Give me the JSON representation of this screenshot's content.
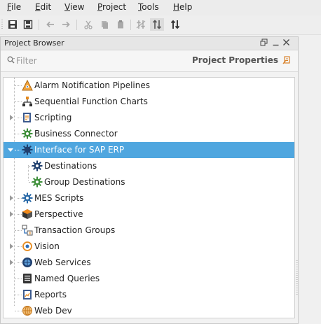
{
  "menu": {
    "items": [
      {
        "label": "File",
        "mnemonic": "F",
        "rest": "ile"
      },
      {
        "label": "Edit",
        "mnemonic": "E",
        "rest": "dit"
      },
      {
        "label": "View",
        "mnemonic": "V",
        "rest": "iew"
      },
      {
        "label": "Project",
        "mnemonic": "P",
        "rest": "roject"
      },
      {
        "label": "Tools",
        "mnemonic": "T",
        "rest": "ools"
      },
      {
        "label": "Help",
        "mnemonic": "H",
        "rest": "elp"
      }
    ]
  },
  "toolbar": {
    "buttons": [
      "save-icon",
      "save-all-icon",
      "undo-icon",
      "redo-icon",
      "cut-icon",
      "copy-icon",
      "paste-icon",
      "comms-off-icon",
      "comms-read-only-icon",
      "comms-read-write-icon"
    ],
    "active": "comms-read-only-icon"
  },
  "panel": {
    "title": "Project Browser",
    "filter_placeholder": "Filter",
    "project_properties_label": "Project Properties",
    "controls": [
      "restore-icon",
      "minimize-icon",
      "close-icon"
    ]
  },
  "tree": {
    "items": [
      {
        "label": "Alarm Notification Pipelines",
        "icon": "alarm-pipeline-icon",
        "expandable": false
      },
      {
        "label": "Sequential Function Charts",
        "icon": "sfc-icon",
        "expandable": false
      },
      {
        "label": "Scripting",
        "icon": "scripting-icon",
        "expandable": true,
        "expanded": false
      },
      {
        "label": "Business Connector",
        "icon": "business-connector-icon",
        "expandable": false
      },
      {
        "label": "Interface for SAP ERP",
        "icon": "sap-interface-icon",
        "expandable": true,
        "expanded": true,
        "selected": true
      },
      {
        "label": "Destinations",
        "icon": "destinations-icon",
        "child": true
      },
      {
        "label": "Group Destinations",
        "icon": "group-destinations-icon",
        "child": true
      },
      {
        "label": "MES Scripts",
        "icon": "mes-scripts-icon",
        "expandable": true,
        "expanded": false
      },
      {
        "label": "Perspective",
        "icon": "perspective-icon",
        "expandable": true,
        "expanded": false
      },
      {
        "label": "Transaction Groups",
        "icon": "transaction-groups-icon",
        "expandable": false
      },
      {
        "label": "Vision",
        "icon": "vision-icon",
        "expandable": true,
        "expanded": false
      },
      {
        "label": "Web Services",
        "icon": "web-services-icon",
        "expandable": true,
        "expanded": false
      },
      {
        "label": "Named Queries",
        "icon": "named-queries-icon",
        "expandable": false
      },
      {
        "label": "Reports",
        "icon": "reports-icon",
        "expandable": false
      },
      {
        "label": "Web Dev",
        "icon": "web-dev-icon",
        "expandable": false
      }
    ]
  },
  "colors": {
    "selection": "#4fa6df",
    "panel_bg": "#f2f2f2",
    "tree_bg": "#ffffff"
  }
}
